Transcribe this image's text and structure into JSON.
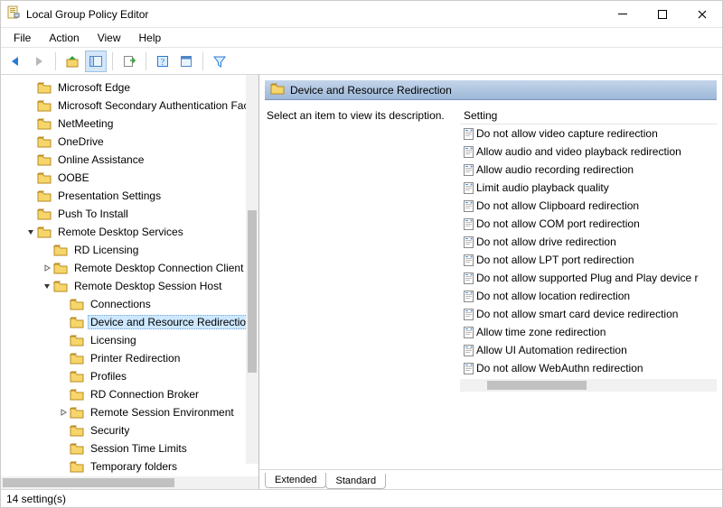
{
  "window": {
    "title": "Local Group Policy Editor"
  },
  "menu": {
    "items": [
      "File",
      "Action",
      "View",
      "Help"
    ]
  },
  "content_header": "Device and Resource Redirection",
  "description_prompt": "Select an item to view its description.",
  "setting_header": "Setting",
  "tabs": {
    "extended": "Extended",
    "standard": "Standard"
  },
  "statusbar": "14 setting(s)",
  "tree": [
    {
      "indent": 0,
      "twisty": "",
      "label": "Microsoft Edge"
    },
    {
      "indent": 0,
      "twisty": "",
      "label": "Microsoft Secondary Authentication Fact"
    },
    {
      "indent": 0,
      "twisty": "",
      "label": "NetMeeting"
    },
    {
      "indent": 0,
      "twisty": "",
      "label": "OneDrive"
    },
    {
      "indent": 0,
      "twisty": "",
      "label": "Online Assistance"
    },
    {
      "indent": 0,
      "twisty": "",
      "label": "OOBE"
    },
    {
      "indent": 0,
      "twisty": "",
      "label": "Presentation Settings"
    },
    {
      "indent": 0,
      "twisty": "",
      "label": "Push To Install"
    },
    {
      "indent": 0,
      "twisty": "open",
      "label": "Remote Desktop Services"
    },
    {
      "indent": 1,
      "twisty": "",
      "label": "RD Licensing"
    },
    {
      "indent": 1,
      "twisty": "closed",
      "label": "Remote Desktop Connection Client"
    },
    {
      "indent": 1,
      "twisty": "open",
      "label": "Remote Desktop Session Host"
    },
    {
      "indent": 2,
      "twisty": "",
      "label": "Connections"
    },
    {
      "indent": 2,
      "twisty": "",
      "label": "Device and Resource Redirection",
      "selected": true
    },
    {
      "indent": 2,
      "twisty": "",
      "label": "Licensing"
    },
    {
      "indent": 2,
      "twisty": "",
      "label": "Printer Redirection"
    },
    {
      "indent": 2,
      "twisty": "",
      "label": "Profiles"
    },
    {
      "indent": 2,
      "twisty": "",
      "label": "RD Connection Broker"
    },
    {
      "indent": 2,
      "twisty": "closed",
      "label": "Remote Session Environment"
    },
    {
      "indent": 2,
      "twisty": "",
      "label": "Security"
    },
    {
      "indent": 2,
      "twisty": "",
      "label": "Session Time Limits"
    },
    {
      "indent": 2,
      "twisty": "",
      "label": "Temporary folders"
    }
  ],
  "settings": [
    "Do not allow video capture redirection",
    "Allow audio and video playback redirection",
    "Allow audio recording redirection",
    "Limit audio playback quality",
    "Do not allow Clipboard redirection",
    "Do not allow COM port redirection",
    "Do not allow drive redirection",
    "Do not allow LPT port redirection",
    "Do not allow supported Plug and Play device r",
    "Do not allow location redirection",
    "Do not allow smart card device redirection",
    "Allow time zone redirection",
    "Allow UI Automation redirection",
    "Do not allow WebAuthn redirection"
  ]
}
